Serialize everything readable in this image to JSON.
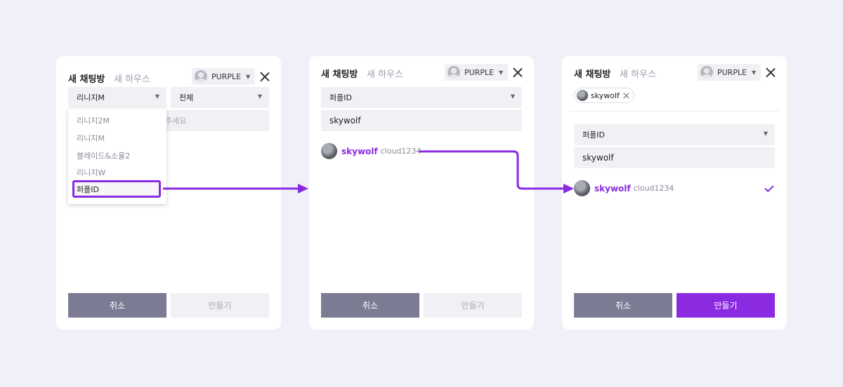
{
  "colors": {
    "accent": "#8a2be2",
    "background": "#f0f0f8",
    "cancel_button": "#7b7c93",
    "disabled_button": "#f1f1f5"
  },
  "panels": [
    {
      "tab_active": "새 채팅방",
      "tab_inactive": "새 하우스",
      "account": "PURPLE",
      "game_select": "리니지M",
      "server_select": "전체",
      "placeholder_tail": "주세요",
      "dropdown": [
        "리니지2M",
        "리니지M",
        "블레이드&소울2",
        "리니지W",
        "퍼플ID"
      ],
      "cancel": "취소",
      "create": "만들기"
    },
    {
      "tab_active": "새 채팅방",
      "tab_inactive": "새 하우스",
      "account": "PURPLE",
      "game_select": "퍼플ID",
      "search_value": "skywolf",
      "result_name": "skywolf",
      "result_id": "cloud1234",
      "cancel": "취소",
      "create": "만들기"
    },
    {
      "tab_active": "새 채팅방",
      "tab_inactive": "새 하우스",
      "account": "PURPLE",
      "chip": "skywolf",
      "game_select": "퍼플ID",
      "search_value": "skywolf",
      "result_name": "skywolf",
      "result_id": "cloud1234",
      "cancel": "취소",
      "create": "만들기"
    }
  ]
}
